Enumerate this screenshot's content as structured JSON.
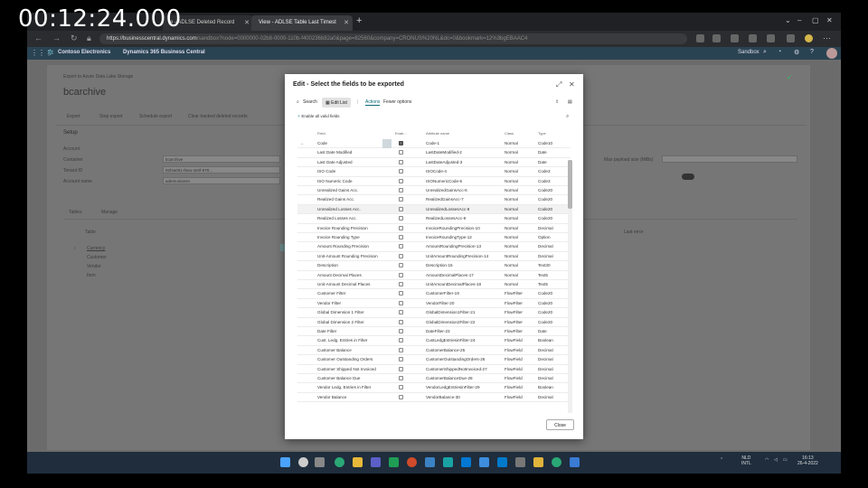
{
  "video": {
    "timecode": "00:12:24.000"
  },
  "browser": {
    "tabs": [
      {
        "label": "e - ADLSE Deleted Record"
      },
      {
        "label": "View - ADLSE Table Last Timest"
      }
    ],
    "address_host": "https://businesscentral.dynamics.com",
    "address_rest": "/sandbox?node=0000000-02b8-0000-110b-f400236b82a0&page=82560&company=CRONUS%20NL&dc=0&bookmark=12%3bgEBAAC4"
  },
  "bc_header": {
    "company": "Contoso Electronics",
    "product": "Dynamics 365 Business Central",
    "environment": "Sandbox"
  },
  "background_page": {
    "breadcrumb": "Export to Azure Data Lake Storage",
    "title": "bcarchive",
    "actions": [
      "Export",
      "Stop export",
      "Schedule export",
      "Clear tracked deleted records"
    ],
    "section": "Setup",
    "subsection": "Account",
    "fields": [
      {
        "label": "Container",
        "value": "bcarchive"
      },
      {
        "label": "Tenant ID",
        "value": "92f4a001-f6ea-4e0f-970..."
      },
      {
        "label": "Account name",
        "value": "ademuniseen"
      }
    ],
    "right_label": "Max payload size (MiBs)",
    "tabs": [
      "Tables",
      "Manage"
    ],
    "list_header": "Table",
    "list_header_right": "Last error",
    "list_items": [
      "Currency",
      "Customer",
      "Vendor",
      "Item"
    ]
  },
  "dialog": {
    "title": "Edit - Select the fields to be exported",
    "toolbar": {
      "search": "Search",
      "edit_list": "Edit List",
      "actions": "Actions",
      "fewer_options": "Fewer options"
    },
    "enable_all": "Enable all valid fields",
    "columns": {
      "field": "Field",
      "enabled": "Enab...",
      "attribute": "Attribute name",
      "class": "Class",
      "type": "Type"
    },
    "rows": [
      {
        "field": "Code",
        "enabled": true,
        "attribute": "Code-1",
        "class": "Normal",
        "type": "Code10"
      },
      {
        "field": "Last Date Modified",
        "enabled": false,
        "attribute": "LastDateModified-2",
        "class": "Normal",
        "type": "Date"
      },
      {
        "field": "Last Date Adjusted",
        "enabled": false,
        "attribute": "LastDateAdjusted-3",
        "class": "Normal",
        "type": "Date"
      },
      {
        "field": "ISO Code",
        "enabled": false,
        "attribute": "ISOCode-4",
        "class": "Normal",
        "type": "Code3"
      },
      {
        "field": "ISO Numeric Code",
        "enabled": false,
        "attribute": "ISONumericCode-5",
        "class": "Normal",
        "type": "Code3"
      },
      {
        "field": "Unrealized Gains Acc.",
        "enabled": false,
        "attribute": "UnrealizedGainsAcc-6",
        "class": "Normal",
        "type": "Code20"
      },
      {
        "field": "Realized Gains Acc.",
        "enabled": false,
        "attribute": "RealizedGainsAcc-7",
        "class": "Normal",
        "type": "Code20"
      },
      {
        "field": "Unrealized Losses Acc.",
        "enabled": false,
        "attribute": "UnrealizedLossesAcc-8",
        "class": "Normal",
        "type": "Code20"
      },
      {
        "field": "Realized Losses Acc.",
        "enabled": false,
        "attribute": "RealizedLossesAcc-9",
        "class": "Normal",
        "type": "Code20"
      },
      {
        "field": "Invoice Rounding Precision",
        "enabled": false,
        "attribute": "InvoiceRoundingPrecision-10",
        "class": "Normal",
        "type": "Decimal"
      },
      {
        "field": "Invoice Rounding Type",
        "enabled": false,
        "attribute": "InvoiceRoundingType-12",
        "class": "Normal",
        "type": "Option"
      },
      {
        "field": "Amount Rounding Precision",
        "enabled": false,
        "attribute": "AmountRoundingPrecision-13",
        "class": "Normal",
        "type": "Decimal"
      },
      {
        "field": "Unit-Amount Rounding Precision",
        "enabled": false,
        "attribute": "UnitAmountRoundingPrecision-14",
        "class": "Normal",
        "type": "Decimal"
      },
      {
        "field": "Description",
        "enabled": false,
        "attribute": "Description-15",
        "class": "Normal",
        "type": "Text30"
      },
      {
        "field": "Amount Decimal Places",
        "enabled": false,
        "attribute": "AmountDecimalPlaces-17",
        "class": "Normal",
        "type": "Text5"
      },
      {
        "field": "Unit-Amount Decimal Places",
        "enabled": false,
        "attribute": "UnitAmountDecimalPlaces-18",
        "class": "Normal",
        "type": "Text5"
      },
      {
        "field": "Customer Filter",
        "enabled": false,
        "attribute": "CustomerFilter-19",
        "class": "FlowFilter",
        "type": "Code20"
      },
      {
        "field": "Vendor Filter",
        "enabled": false,
        "attribute": "VendorFilter-20",
        "class": "FlowFilter",
        "type": "Code20"
      },
      {
        "field": "Global Dimension 1 Filter",
        "enabled": false,
        "attribute": "GlobalDimension1Filter-21",
        "class": "FlowFilter",
        "type": "Code20"
      },
      {
        "field": "Global Dimension 2 Filter",
        "enabled": false,
        "attribute": "GlobalDimension2Filter-22",
        "class": "FlowFilter",
        "type": "Code20"
      },
      {
        "field": "Date Filter",
        "enabled": false,
        "attribute": "DateFilter-23",
        "class": "FlowFilter",
        "type": "Date"
      },
      {
        "field": "Cust. Ledg. Entries in Filter",
        "enabled": false,
        "attribute": "CustLedgEntriesinFilter-24",
        "class": "FlowField",
        "type": "Boolean"
      },
      {
        "field": "Customer Balance",
        "enabled": false,
        "attribute": "CustomerBalance-25",
        "class": "FlowField",
        "type": "Decimal"
      },
      {
        "field": "Customer Outstanding Orders",
        "enabled": false,
        "attribute": "CustomerOutstandingOrders-26",
        "class": "FlowField",
        "type": "Decimal"
      },
      {
        "field": "Customer Shipped Not Invoiced",
        "enabled": false,
        "attribute": "CustomerShippedNotInvoiced-27",
        "class": "FlowField",
        "type": "Decimal"
      },
      {
        "field": "Customer Balance Due",
        "enabled": false,
        "attribute": "CustomerBalanceDue-28",
        "class": "FlowField",
        "type": "Decimal"
      },
      {
        "field": "Vendor Ledg. Entries in Filter",
        "enabled": false,
        "attribute": "VendorLedgEntriesinFilter-29",
        "class": "FlowField",
        "type": "Boolean"
      },
      {
        "field": "Vendor Balance",
        "enabled": false,
        "attribute": "VendorBalance-30",
        "class": "FlowField",
        "type": "Decimal"
      }
    ],
    "close_label": "Close"
  },
  "taskbar": {
    "lang": "NLD",
    "lang2": "INTL",
    "time": "16:13",
    "date": "26-4-2022"
  },
  "colors": {
    "accent": "#0b6a75",
    "header": "#2a4352",
    "taskbar": "#1f2d3d"
  }
}
